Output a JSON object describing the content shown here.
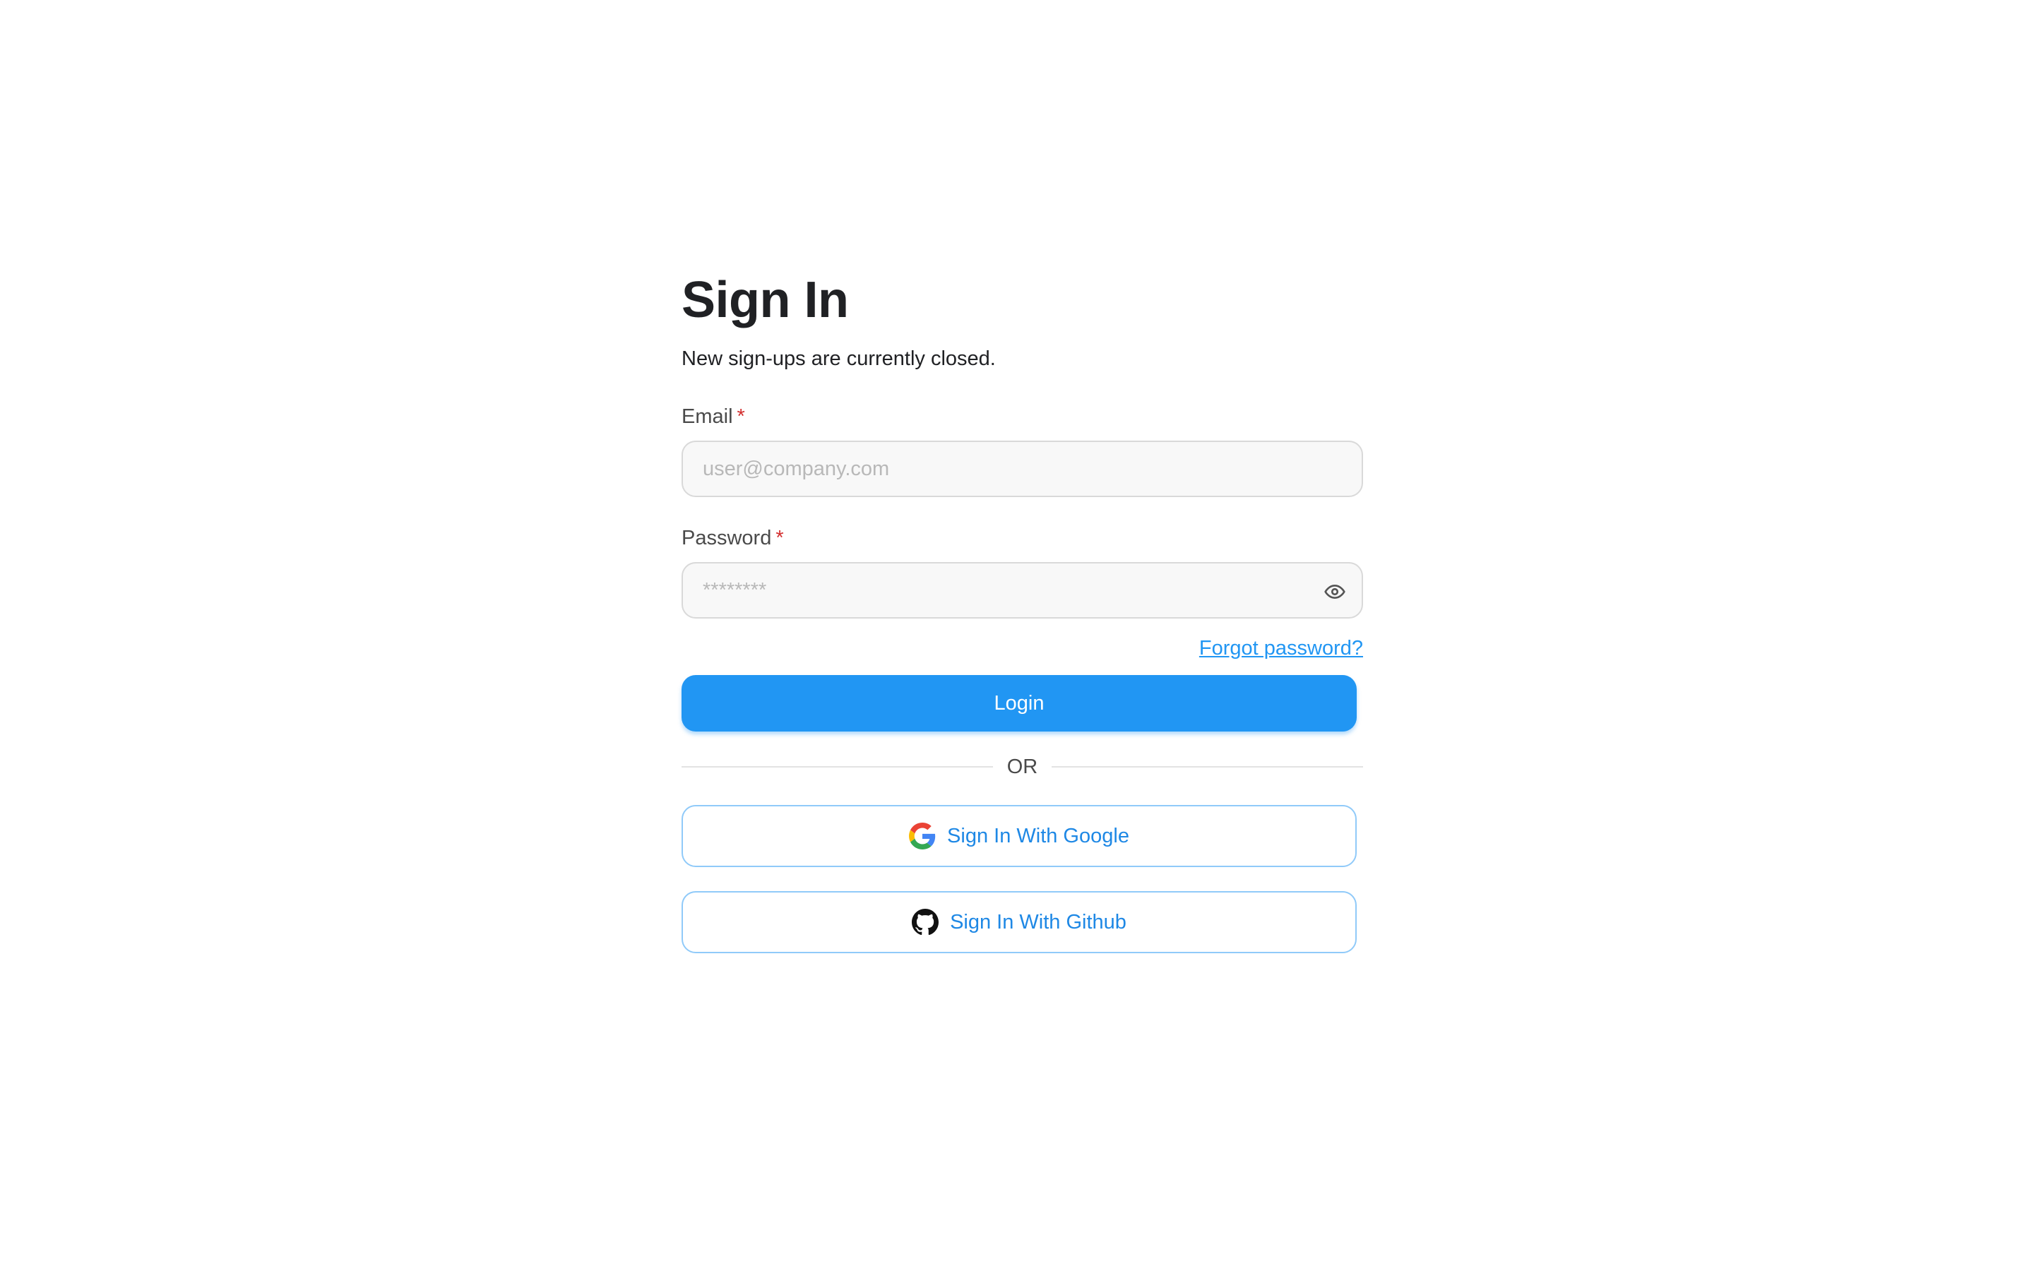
{
  "header": {
    "title": "Sign In",
    "subtitle": "New sign-ups are currently closed."
  },
  "form": {
    "email": {
      "label": "Email",
      "required_mark": "*",
      "placeholder": "user@company.com",
      "value": ""
    },
    "password": {
      "label": "Password",
      "required_mark": "*",
      "placeholder": "********",
      "value": "",
      "toggle_icon": "eye-icon"
    },
    "forgot_password_label": "Forgot password?",
    "login_label": "Login",
    "divider_label": "OR"
  },
  "social": {
    "google": {
      "label": "Sign In With Google",
      "icon": "google-icon"
    },
    "github": {
      "label": "Sign In With Github",
      "icon": "github-icon"
    }
  },
  "colors": {
    "primary": "#2196f3",
    "required": "#d32f2f",
    "social_border": "#90caf9",
    "social_text": "#1e88e5"
  }
}
